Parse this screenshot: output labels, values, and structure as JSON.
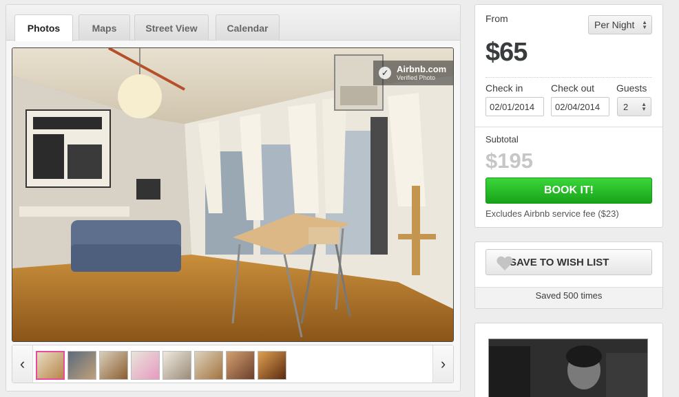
{
  "tabs": [
    {
      "label": "Photos",
      "active": true
    },
    {
      "label": "Maps",
      "active": false
    },
    {
      "label": "Street View",
      "active": false
    },
    {
      "label": "Calendar",
      "active": false
    }
  ],
  "photo": {
    "badge_title": "Airbnb.com",
    "badge_subtitle": "Verified Photo",
    "thumbnail_count": 8,
    "selected_thumbnail": 1
  },
  "booking": {
    "from_label": "From",
    "rate_option": "Per Night",
    "price": "$65",
    "check_in_label": "Check in",
    "check_out_label": "Check out",
    "guests_label": "Guests",
    "check_in_value": "02/01/2014",
    "check_out_value": "02/04/2014",
    "guests_value": "2",
    "subtotal_label": "Subtotal",
    "subtotal_value": "$195",
    "book_label": "BOOK IT!",
    "fee_note": "Excludes Airbnb service fee ($23)"
  },
  "wishlist": {
    "button_label": "SAVE TO WISH LIST",
    "saved_text": "Saved 500 times"
  },
  "colors": {
    "book_green": "#18a318",
    "thumbnail_selected": "#e64a9b",
    "subtotal_gray": "#c6c6c6"
  }
}
